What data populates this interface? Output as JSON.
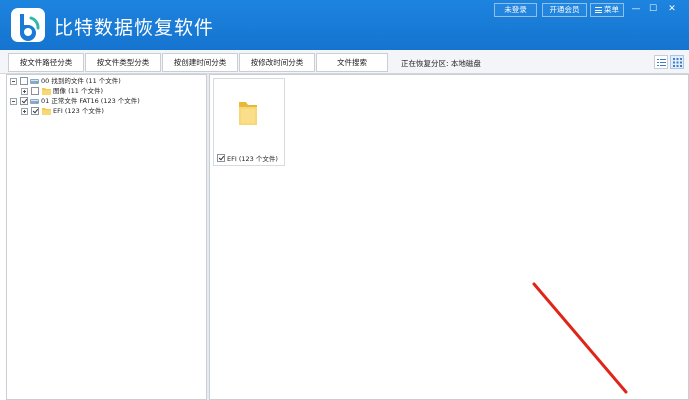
{
  "titlebar": {
    "app_title": "比特数据恢复软件",
    "login_label": "未登录",
    "vip_label": "开通会员",
    "menu_label": "菜单",
    "minimize_glyph": "—",
    "maximize_glyph": "☐",
    "close_glyph": "✕"
  },
  "toolbar": {
    "tabs": [
      {
        "label": "按文件路径分类"
      },
      {
        "label": "按文件类型分类"
      },
      {
        "label": "按创建时间分类"
      },
      {
        "label": "按修改时间分类"
      },
      {
        "label": "文件搜索"
      }
    ],
    "scan_status": "正在恢复分区: 本地磁盘"
  },
  "tree": {
    "nodes": [
      {
        "label": "00 找到的文件 (11 个文件)",
        "checked": false,
        "icon": "drive-icon"
      },
      {
        "label": "图像   (11 个文件)",
        "checked": false,
        "icon": "folder-icon"
      },
      {
        "label": "01 正常文件 FAT16 (123 个文件)",
        "checked": true,
        "icon": "drive-icon"
      },
      {
        "label": "EFI  (123 个文件)",
        "checked": true,
        "icon": "folder-icon"
      }
    ]
  },
  "grid": {
    "items": [
      {
        "label": "EFI (123 个文件)",
        "checked": true,
        "icon": "folder-icon"
      }
    ]
  },
  "colors": {
    "titlebar": "#1a7ad6",
    "folder": "#f8d775",
    "arrow": "#e02418"
  }
}
